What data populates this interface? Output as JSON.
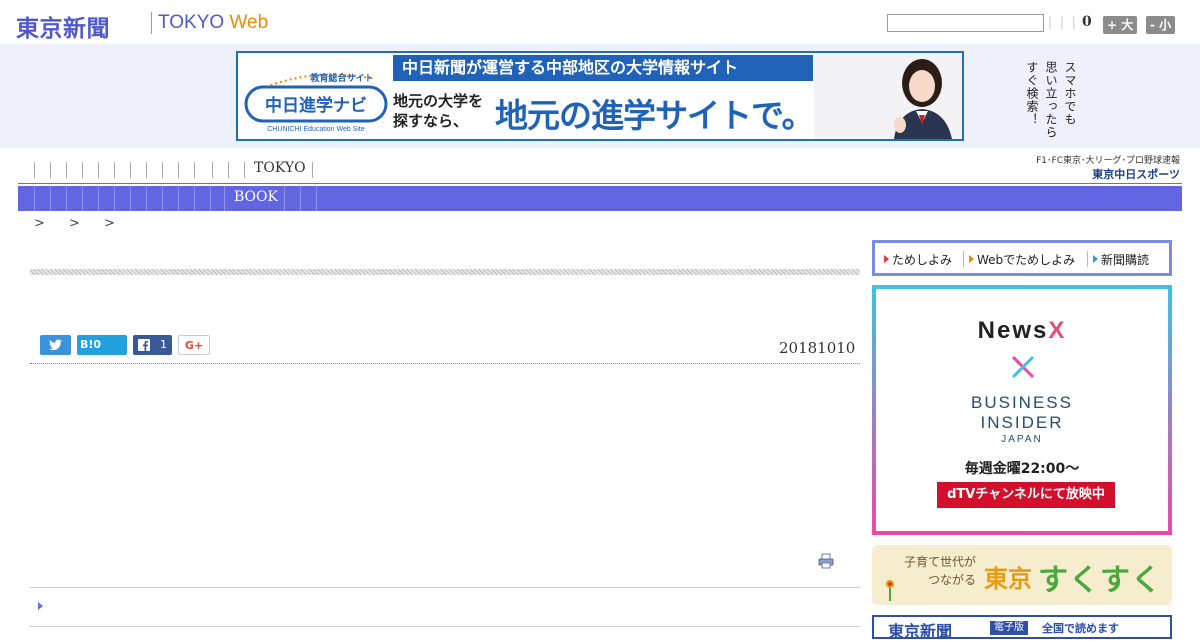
{
  "header": {
    "logo_jp": "東京新聞",
    "logo_en_prefix": "TOKYO ",
    "logo_en_web": "Web",
    "search": {
      "value": "",
      "placeholder": ""
    },
    "separators": "| | |",
    "counter": "0",
    "font_larger": "+ 大",
    "font_smaller": "- 小"
  },
  "banner": {
    "logo_top": "教育総合サイト",
    "logo_main": "中日進学ナビ",
    "logo_sub": "CHUNICHI Education Web Site",
    "top_line": "中日新聞が運営する中部地区の大学情報サイト",
    "left_line1": "地元の大学を",
    "left_line2": "探すなら、",
    "big_line": "地元の進学サイトで。",
    "vertical_lines": [
      "スマホでも",
      "思い立ったら",
      "すぐ検索！"
    ]
  },
  "nav1": {
    "tokyo": "TOKYO",
    "sports_line1": "F1･FC東京･大リーグ･プロ野球速報",
    "sports_line2": "東京中日スポーツ"
  },
  "nav2": {
    "book": "BOOK"
  },
  "breadcrumb": "> > >",
  "article": {
    "share_hatena": "B!0",
    "share_facebook_count": "1",
    "share_gplus": "G+",
    "date": "20181010"
  },
  "subscribe": {
    "items": [
      "ためしよみ",
      "Webでためしよみ",
      "新聞購読"
    ]
  },
  "ad": {
    "newsx_prefix": "News",
    "newsx_x": "X",
    "bi_line1": "BUSINESS",
    "bi_line2": "INSIDER",
    "bi_line3": "JAPAN",
    "weekly": "毎週金曜22:00〜",
    "dtv": "dTVチャンネルにて放映中"
  },
  "sukusuku": {
    "line1": "子育て世代が",
    "line2": "つながる",
    "tokyo": "東京",
    "main": "すくすく"
  },
  "bottom_ad": {
    "title": "東京新聞",
    "badge": "電子版",
    "tagline": "全国で読めます"
  },
  "colors": {
    "brand": "#5159c9",
    "nav_bar": "#6266e2",
    "accent_orange": "#f08a00",
    "dtv_red": "#d3102c"
  }
}
